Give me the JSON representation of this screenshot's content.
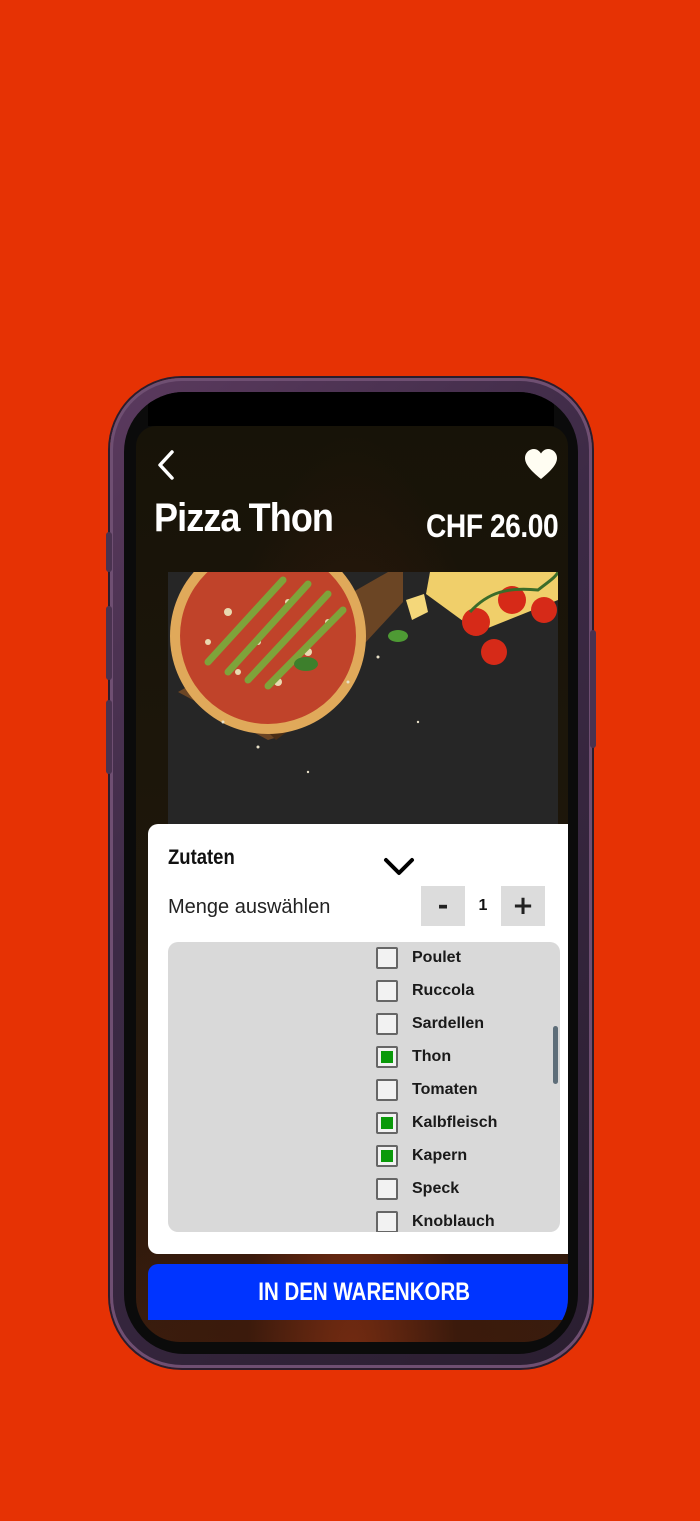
{
  "product": {
    "title": "Pizza Thon",
    "price": "CHF 26.00"
  },
  "card": {
    "title": "Zutaten",
    "quantity_label": "Menge auswählen",
    "minus_label": "-",
    "plus_label": "+",
    "quantity_value": "1"
  },
  "ingredients": [
    {
      "label": "Poulet",
      "checked": false
    },
    {
      "label": "Ruccola",
      "checked": false
    },
    {
      "label": "Sardellen",
      "checked": false
    },
    {
      "label": "Thon",
      "checked": true
    },
    {
      "label": "Tomaten",
      "checked": false
    },
    {
      "label": "Kalbfleisch",
      "checked": true
    },
    {
      "label": "Kapern",
      "checked": true
    },
    {
      "label": "Speck",
      "checked": false
    },
    {
      "label": "Knoblauch",
      "checked": false
    }
  ],
  "cart_button": {
    "label": "IN DEN WARENKORB"
  },
  "icons": {
    "back": "back-icon",
    "favorite": "heart-icon",
    "expand": "chevron-down-icon"
  },
  "colors": {
    "background": "#e63204",
    "cart_button": "#0034ff",
    "checked": "#0a9a0a"
  }
}
